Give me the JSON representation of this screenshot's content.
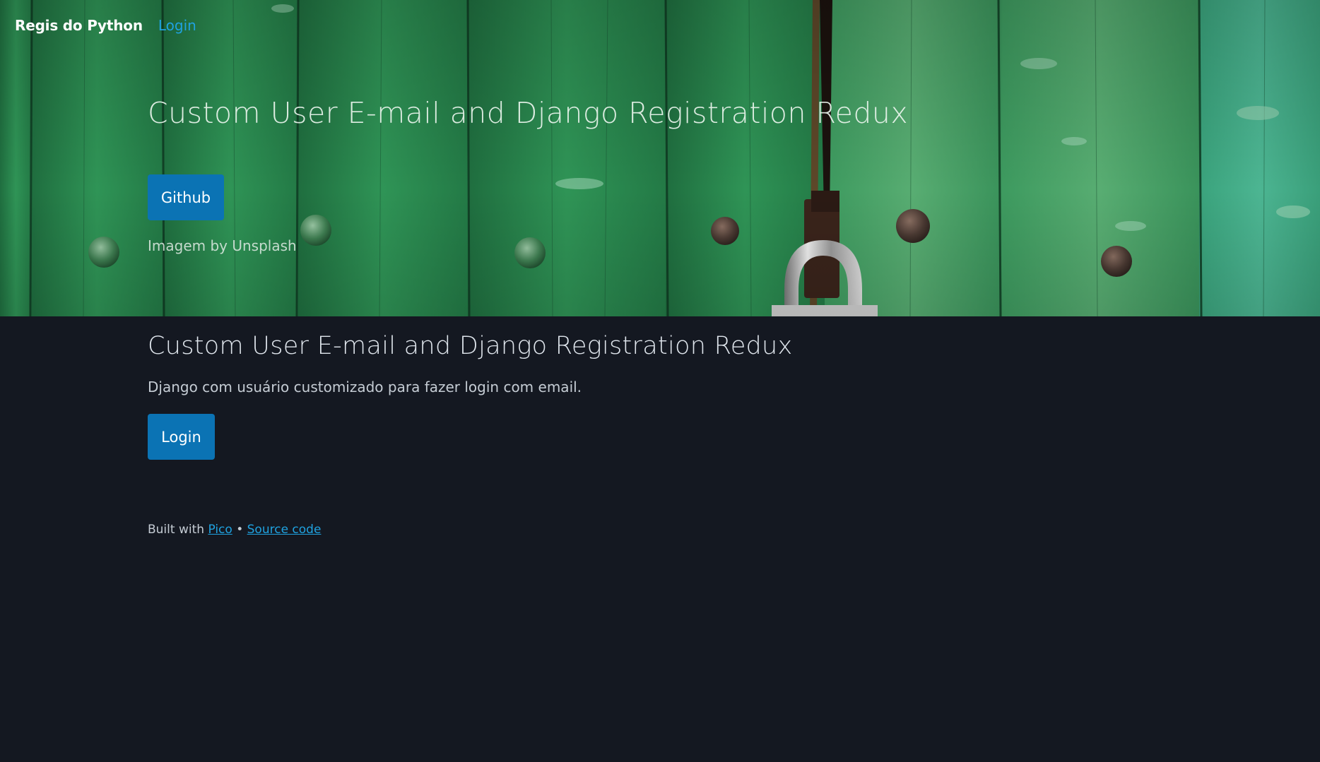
{
  "nav": {
    "brand": "Regis do Python",
    "login_link": "Login"
  },
  "hero": {
    "title": "Custom User E-mail and Django Registration Redux",
    "github_button": "Github",
    "credit": "Imagem by Unsplash"
  },
  "main": {
    "title": "Custom User E-mail and Django Registration Redux",
    "description": "Django com usuário customizado para fazer login com email.",
    "login_button": "Login"
  },
  "footer": {
    "prefix": "Built with ",
    "pico_link": "Pico",
    "separator": " • ",
    "source_link": "Source code"
  },
  "colors": {
    "page_bg": "#141821",
    "primary": "#0b73b4",
    "link": "#1fa2e0",
    "hero_green": "#2e8d53"
  }
}
